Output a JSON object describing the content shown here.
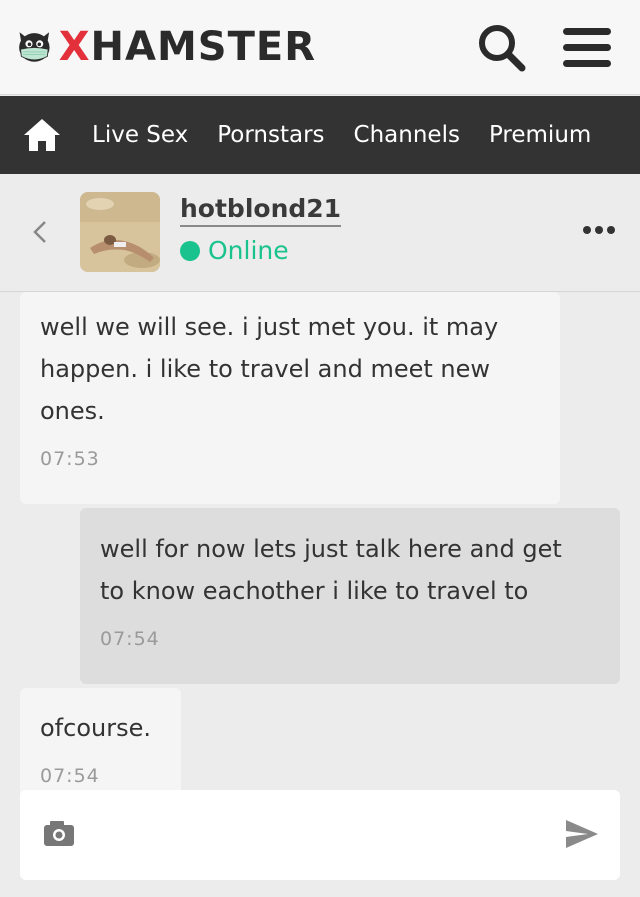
{
  "header": {
    "logo_text_x": "X",
    "logo_text_rest": "HAMSTER"
  },
  "nav": {
    "items": [
      {
        "label": "Live Sex"
      },
      {
        "label": "Pornstars"
      },
      {
        "label": "Channels"
      },
      {
        "label": "Premium"
      }
    ]
  },
  "chat": {
    "user_name": "hotblond21",
    "status": "Online",
    "status_color": "#1ac38d"
  },
  "messages": [
    {
      "direction": "in",
      "lines": [
        "well we will see. i just met you. it may",
        "happen. i like to travel and meet new",
        "ones."
      ],
      "time": "07:53"
    },
    {
      "direction": "out",
      "lines": [
        "well for now lets just talk here and get",
        "to know eachother i like to travel to"
      ],
      "time": "07:54"
    },
    {
      "direction": "in",
      "lines": [
        "ofcourse."
      ],
      "time": "07:54"
    }
  ],
  "composer": {
    "placeholder": ""
  },
  "icons": {
    "home": "home-icon",
    "search": "search-icon",
    "menu": "hamburger-menu-icon",
    "back": "chevron-left-icon",
    "more": "more-dots-icon",
    "camera": "camera-icon",
    "send": "send-icon"
  },
  "colors": {
    "brand_red": "#e2313b",
    "nav_bg": "#333333",
    "online_green": "#1ac38d"
  }
}
